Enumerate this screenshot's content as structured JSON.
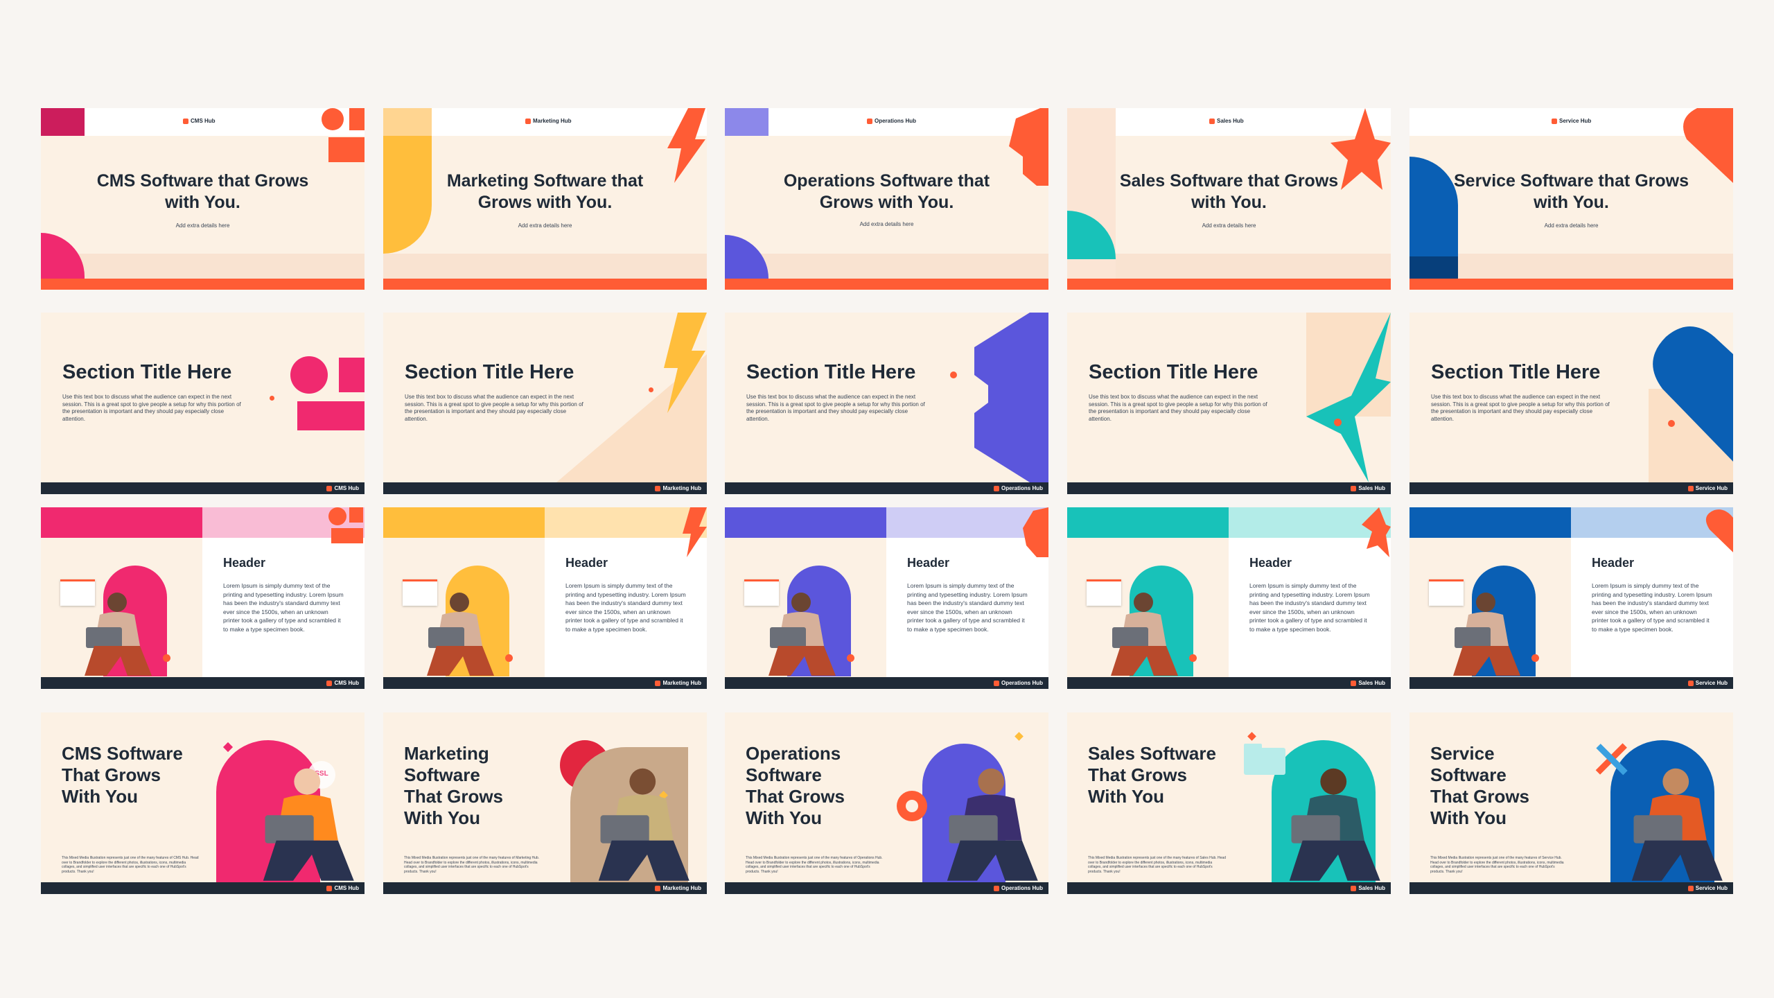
{
  "hubs": [
    {
      "key": "cms",
      "name": "CMS Hub",
      "color": "#f0296f",
      "accent": "#ff5c35"
    },
    {
      "key": "marketing",
      "name": "Marketing Hub",
      "color": "#ffbe3c",
      "accent": "#ff5c35"
    },
    {
      "key": "operations",
      "name": "Operations Hub",
      "color": "#5b56dc",
      "accent": "#ff5c35"
    },
    {
      "key": "sales",
      "name": "Sales Hub",
      "color": "#18c2b9",
      "accent": "#ff5c35"
    },
    {
      "key": "service",
      "name": "Service Hub",
      "color": "#0a5fb4",
      "accent": "#ff5c35"
    }
  ],
  "title_slides": [
    {
      "hub": "CMS Hub",
      "title": "CMS Software that Grows with You.",
      "subtitle": "Add extra details here"
    },
    {
      "hub": "Marketing Hub",
      "title": "Marketing Software that Grows with You.",
      "subtitle": "Add extra details here"
    },
    {
      "hub": "Operations Hub",
      "title": "Operations Software that Grows with You.",
      "subtitle": "Add extra details here"
    },
    {
      "hub": "Sales Hub",
      "title": "Sales Software that Grows with You.",
      "subtitle": "Add extra details here"
    },
    {
      "hub": "Service Hub",
      "title": "Service Software that Grows with You.",
      "subtitle": "Add extra details here"
    }
  ],
  "section_slides": {
    "title": "Section Title Here",
    "body": "Use this text box to discuss what the audience can expect in the next session. This is a great spot to give people a setup for why this portion of the presentation is important and they should pay especially close attention."
  },
  "content_slides": {
    "header": "Header",
    "body": "Lorem Ipsum is simply dummy text of the printing and typesetting industry. Lorem Ipsum has been the industry's standard dummy text ever since the 1500s, when an unknown printer took a gallery of type and scrambled it to make a type specimen book."
  },
  "closing_slides": [
    {
      "title": "CMS Software\nThat Grows\nWith You",
      "caption": "This Mixed Media Illustration represents just one of the many features of CMS Hub. Head over to Brandfolder to explore the different photos, illustrations, icons, multimedia collages, and simplified user interfaces that are specific to each one of HubSpot's products. Thank you!",
      "badge": "SSL"
    },
    {
      "title": "Marketing\nSoftware\nThat Grows\nWith You",
      "caption": "This Mixed Media Illustration represents just one of the many features of Marketing Hub. Head over to Brandfolder to explore the different photos, illustrations, icons, multimedia collages, and simplified user interfaces that are specific to each one of HubSpot's products. Thank you!"
    },
    {
      "title": "Operations\nSoftware\nThat Grows\nWith You",
      "caption": "This Mixed Media Illustration represents just one of the many features of Operations Hub. Head over to Brandfolder to explore the different photos, illustrations, icons, multimedia collages, and simplified user interfaces that are specific to each one of HubSpot's products. Thank you!"
    },
    {
      "title": "Sales Software\nThat Grows\nWith You",
      "caption": "This Mixed Media Illustration represents just one of the many features of Sales Hub. Head over to Brandfolder to explore the different photos, illustrations, icons, multimedia collages, and simplified user interfaces that are specific to each one of HubSpot's products. Thank you!"
    },
    {
      "title": "Service\nSoftware\nThat Grows\nWith You",
      "caption": "This Mixed Media Illustration represents just one of the many features of Service Hub. Head over to Brandfolder to explore the different photos, illustrations, icons, multimedia collages, and simplified user interfaces that are specific to each one of HubSpot's products. Thank you!"
    }
  ]
}
